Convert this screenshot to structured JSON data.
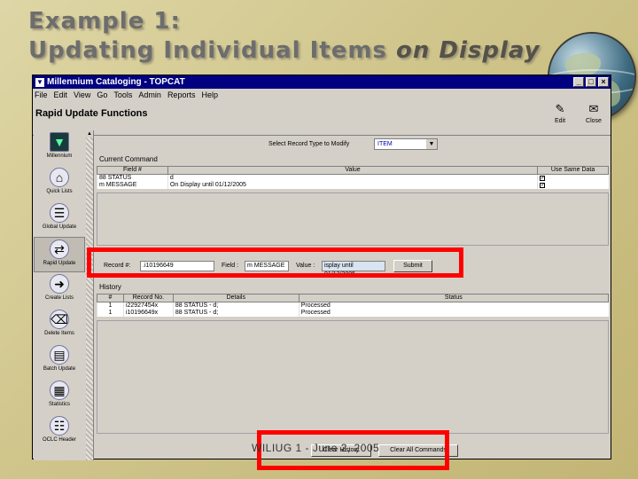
{
  "slide": {
    "title_line1": "Example 1:",
    "title_line2_normal": "Updating Individual Items ",
    "title_line2_italic": "on Display",
    "footer": "WILIUG 1 - June 2, 2005"
  },
  "window": {
    "title": "Millennium Cataloging - TOPCAT",
    "controls": [
      "_",
      "□",
      "×"
    ]
  },
  "menu": [
    "File",
    "Edit",
    "View",
    "Go",
    "Tools",
    "Admin",
    "Reports",
    "Help"
  ],
  "function_title": "Rapid Update Functions",
  "toolbar": {
    "edit_label": "Edit",
    "close_label": "Close"
  },
  "sidebar": [
    {
      "label": "Millennium",
      "icon": "millennium-logo-icon"
    },
    {
      "label": "Quick Lists",
      "icon": "quick-lists-icon"
    },
    {
      "label": "Global Update",
      "icon": "global-update-icon"
    },
    {
      "label": "Rapid Update",
      "icon": "rapid-update-icon"
    },
    {
      "label": "Create Lists",
      "icon": "create-lists-icon"
    },
    {
      "label": "Delete Items",
      "icon": "delete-items-icon"
    },
    {
      "label": "Batch Update",
      "icon": "batch-update-icon"
    },
    {
      "label": "Statistics",
      "icon": "statistics-icon"
    },
    {
      "label": "OCLC Header",
      "icon": "oclc-header-icon"
    }
  ],
  "record_type": {
    "label": "Select Record Type to Modify",
    "value": "ITEM"
  },
  "current_command": {
    "label": "Current Command",
    "columns": [
      "Field #",
      "Value",
      "Use Same Data"
    ],
    "rows": [
      {
        "field": "88 STATUS",
        "value": "d",
        "same": "✓"
      },
      {
        "field": "m MESSAGE",
        "value": "On Display until 01/12/2005",
        "same": "✓"
      }
    ]
  },
  "update": {
    "record_label": "Record #:",
    "record_value": ".i10196649",
    "field_label": "Field :",
    "field_value": "m MESSAGE",
    "value_label": "Value :",
    "value_value": "isplay until 01/12/2005",
    "submit": "Submit"
  },
  "history": {
    "label": "History",
    "columns": [
      "#",
      "Record No.",
      "Details",
      "Status"
    ],
    "rows": [
      {
        "n": "1",
        "record": "i22927454x",
        "details": "88 STATUS - d;",
        "status": "Processed"
      },
      {
        "n": "1",
        "record": "i10196649x",
        "details": "88 STATUS - d;",
        "status": "Processed"
      }
    ]
  },
  "bottom_buttons": {
    "clear_history": "Clear History",
    "clear_commands": "Clear All Commands"
  }
}
